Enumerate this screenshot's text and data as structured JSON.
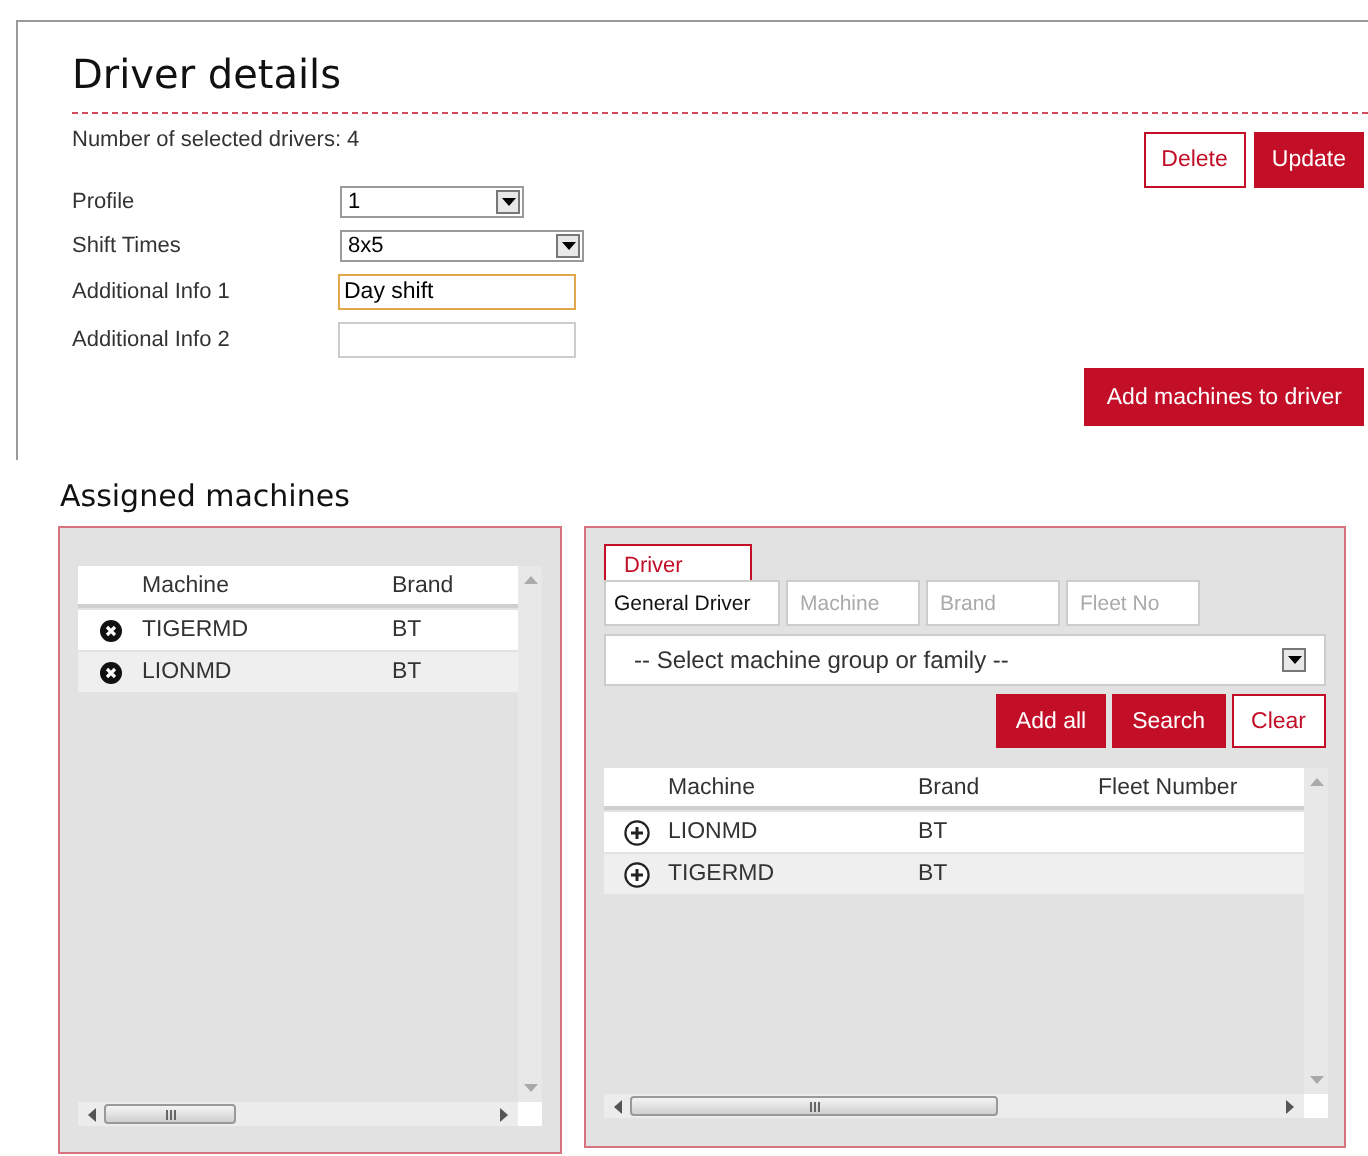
{
  "title": "Driver details",
  "selected_count": "Number of selected drivers: 4",
  "actions": [
    {
      "label": "Delete",
      "kind": "outline"
    },
    {
      "label": "Update",
      "kind": "primary"
    }
  ],
  "form": [
    {
      "label": "Profile",
      "kind": "select",
      "value": "1",
      "focused": false
    },
    {
      "label": "Shift Times",
      "kind": "select",
      "value": "8x5",
      "focused": false
    },
    {
      "label": "Additional Info 1",
      "kind": "text",
      "value": "Day shift",
      "focused": true
    },
    {
      "label": "Additional Info 2",
      "kind": "text",
      "focused": false
    }
  ],
  "add_button": {
    "label": "Add machines to driver"
  },
  "section_heading": "Assigned machines",
  "assigned": {
    "columns": [
      "Machine",
      "Brand"
    ],
    "rows": [
      {
        "cells": [
          "TIGERMD",
          "BT"
        ]
      },
      {
        "cells": [
          "LIONMD",
          "BT"
        ]
      }
    ]
  },
  "search_panel": {
    "tab": {
      "label": "Driver",
      "selected": true
    },
    "filters": [
      {
        "value": "General Driver"
      },
      {
        "placeholder": "Machine"
      },
      {
        "placeholder": "Brand"
      },
      {
        "placeholder": "Fleet No"
      }
    ],
    "group_select": "-- Select machine group or family --",
    "buttons": [
      {
        "label": "Add all",
        "kind": "primary"
      },
      {
        "label": "Search",
        "kind": "primary"
      },
      {
        "label": "Clear",
        "kind": "outline"
      }
    ],
    "results": {
      "columns": [
        "Machine",
        "Brand",
        "Fleet Number"
      ],
      "rows": [
        {
          "cells": [
            "LIONMD",
            "BT"
          ]
        },
        {
          "cells": [
            "TIGERMD",
            "BT"
          ]
        }
      ]
    }
  }
}
